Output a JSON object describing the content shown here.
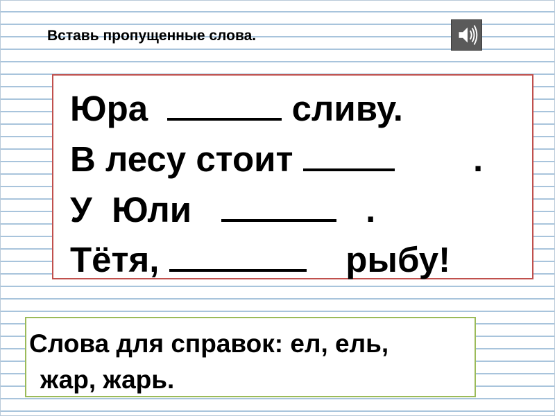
{
  "instruction": "Вставь пропущенные слова.",
  "sound_button": {
    "icon": "speaker-icon"
  },
  "exercise": {
    "line1": {
      "before": "Юра ",
      "after": " сливу."
    },
    "line2": {
      "before": "В лесу стоит ",
      "after": "        ."
    },
    "line3": {
      "before": "У  Юли   ",
      "after": "   ."
    },
    "line4": {
      "before": "Тётя, ",
      "after": "    рыбу!"
    }
  },
  "reference": {
    "line1": "Слова для справок: ел, ель,",
    "line2": "жар, жарь."
  },
  "colors": {
    "exercise_border": "#c0504d",
    "reference_border": "#9bbb59",
    "ruled_lines": "#a8c4dc"
  }
}
